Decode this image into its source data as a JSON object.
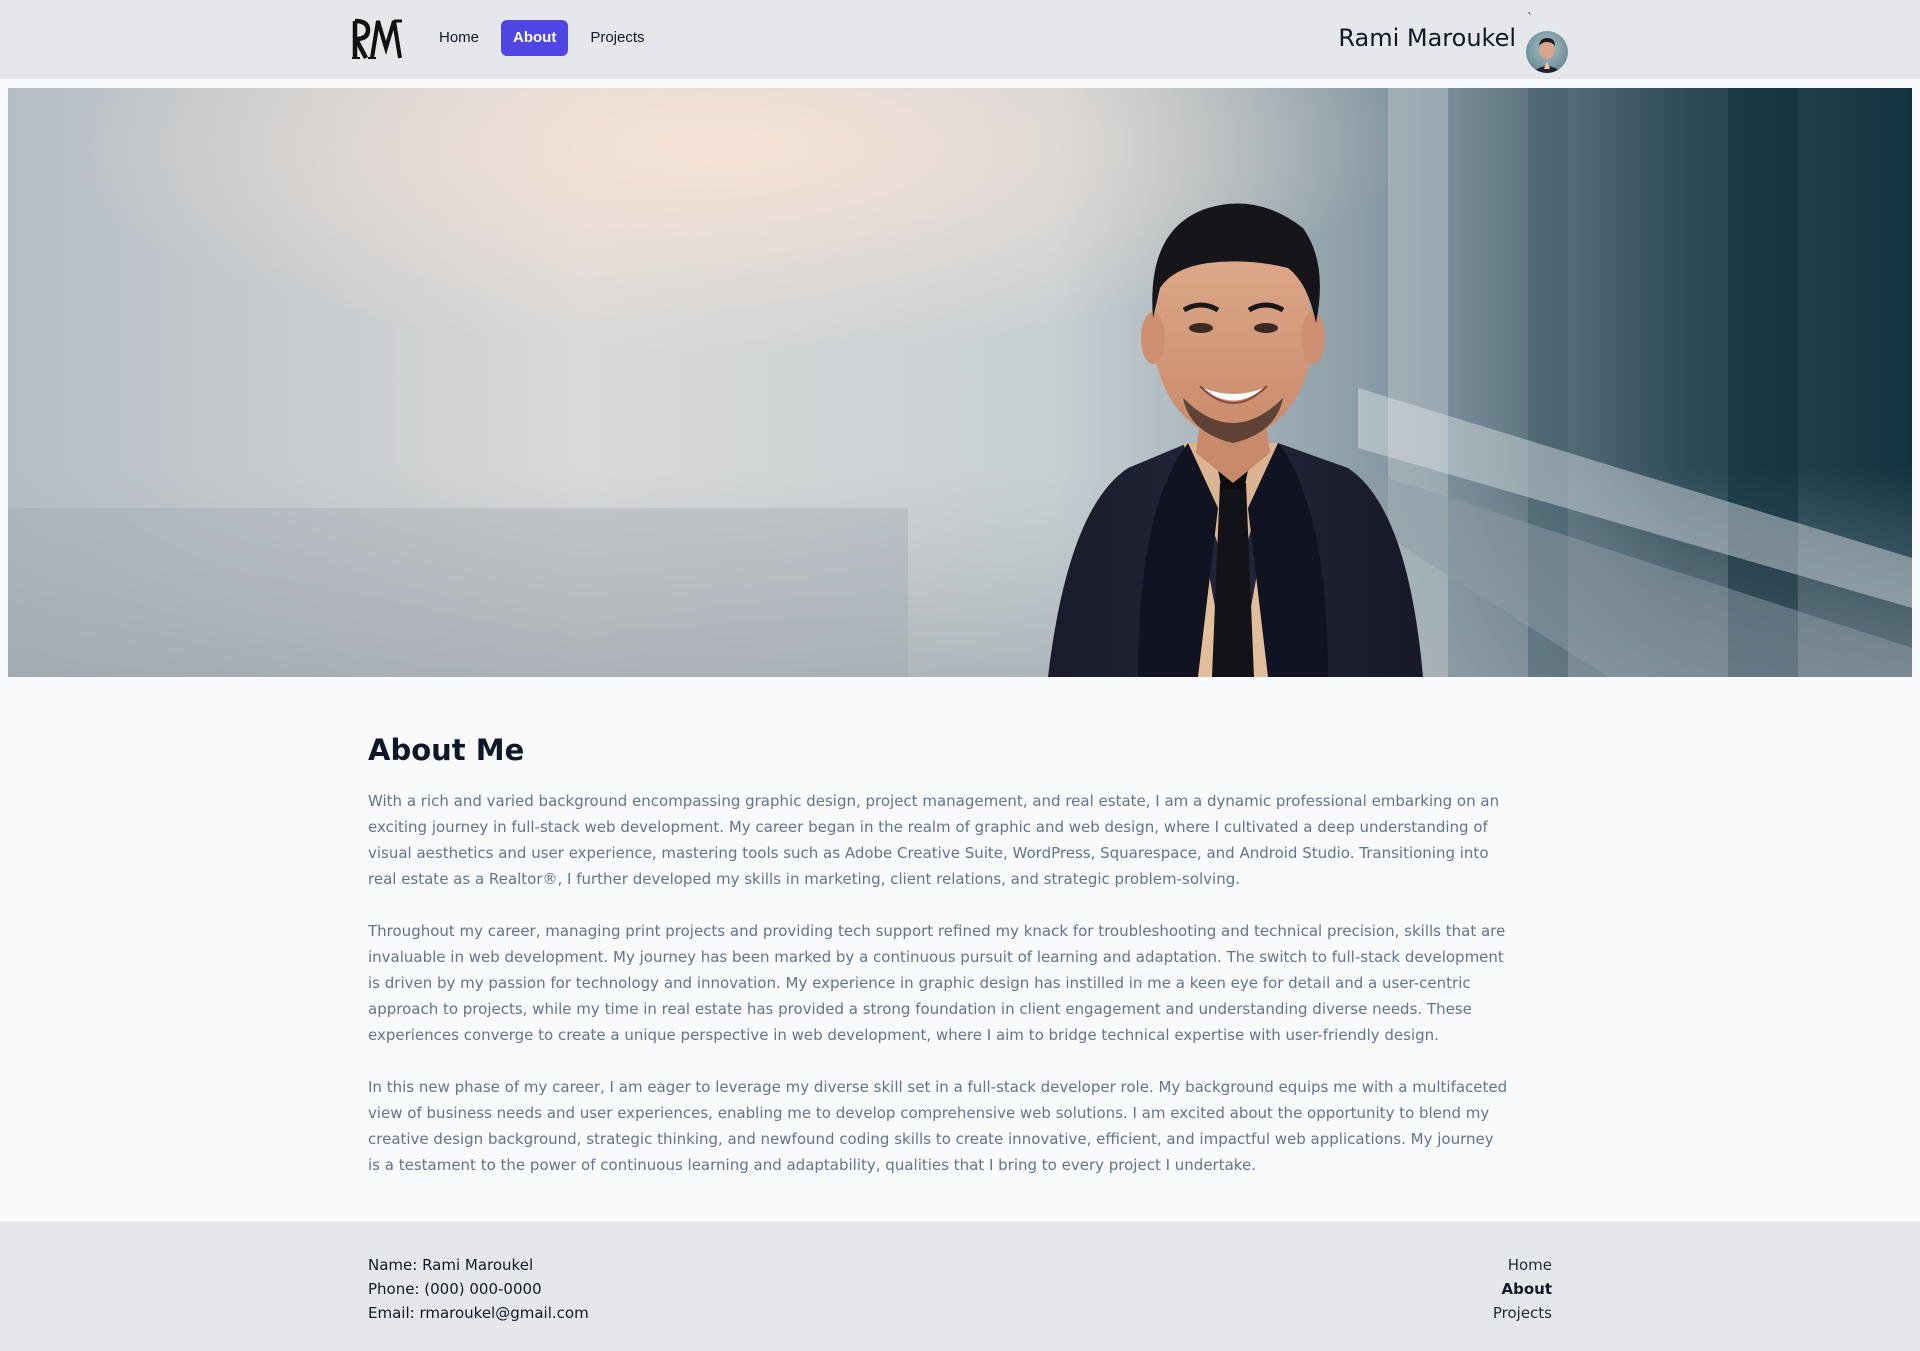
{
  "header": {
    "logo_text": "RM",
    "nav": [
      {
        "label": "Home",
        "active": false
      },
      {
        "label": "About",
        "active": true
      },
      {
        "label": "Projects",
        "active": false
      }
    ],
    "user_name": "Rami Maroukel",
    "avatar_mark": "`"
  },
  "about": {
    "title": "About Me",
    "paragraphs": [
      "With a rich and varied background encompassing graphic design, project management, and real estate, I am a dynamic professional embarking on an exciting journey in full-stack web development. My career began in the realm of graphic and web design, where I cultivated a deep understanding of visual aesthetics and user experience, mastering tools such as Adobe Creative Suite, WordPress, Squarespace, and Android Studio. Transitioning into real estate as a Realtor®, I further developed my skills in marketing, client relations, and strategic problem-solving.",
      "Throughout my career, managing print projects and providing tech support refined my knack for troubleshooting and technical precision, skills that are invaluable in web development. My journey has been marked by a continuous pursuit of learning and adaptation. The switch to full-stack development is driven by my passion for technology and innovation. My experience in graphic design has instilled in me a keen eye for detail and a user-centric approach to projects, while my time in real estate has provided a strong foundation in client engagement and understanding diverse needs. These experiences converge to create a unique perspective in web development, where I aim to bridge technical expertise with user-friendly design.",
      "In this new phase of my career, I am eager to leverage my diverse skill set in a full-stack developer role. My background equips me with a multifaceted view of business needs and user experiences, enabling me to develop comprehensive web solutions. I am excited about the opportunity to blend my creative design background, strategic thinking, and newfound coding skills to create innovative, efficient, and impactful web applications. My journey is a testament to the power of continuous learning and adaptability, qualities that I bring to every project I undertake."
    ]
  },
  "footer": {
    "name": "Name: Rami Maroukel",
    "phone": "Phone: (000) 000-0000",
    "email": "Email: rmaroukel@gmail.com",
    "links": [
      {
        "label": "Home",
        "active": false
      },
      {
        "label": "About",
        "active": true
      },
      {
        "label": "Projects",
        "active": false
      }
    ]
  },
  "colors": {
    "accent": "#4f46e5",
    "header_bg": "#e5e7eb",
    "page_bg": "#f8fafc",
    "body_text": "#64748b"
  },
  "icons": {
    "logo": "rm-monogram-logo",
    "avatar": "profile-photo-avatar",
    "hero": "hero-portrait-photo"
  }
}
